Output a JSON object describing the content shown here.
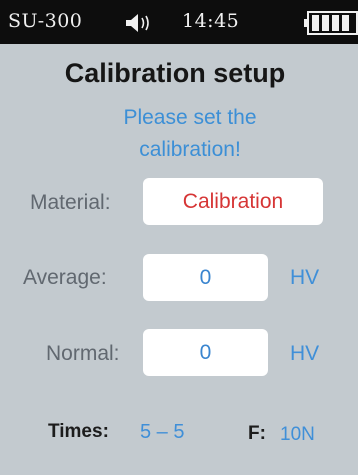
{
  "status_bar": {
    "model": "SU-300",
    "time": "14:45",
    "speaker_icon": "speaker-sound-icon",
    "battery_icon": "battery-full-icon"
  },
  "title": "Calibration setup",
  "prompt": "Please set the calibration!",
  "fields": {
    "material": {
      "label": "Material:",
      "value": "Calibration"
    },
    "average": {
      "label": "Average:",
      "value": "0",
      "unit": "HV"
    },
    "normal": {
      "label": "Normal:",
      "value": "0",
      "unit": "HV"
    }
  },
  "footer": {
    "times_label": "Times:",
    "times_value": "5 – 5",
    "force_label": "F:",
    "force_value": "10N"
  },
  "colors": {
    "background": "#c3cacf",
    "status_bar": "#0d0d0d",
    "accent_blue": "#3c8fd6",
    "material_red": "#d63535"
  }
}
